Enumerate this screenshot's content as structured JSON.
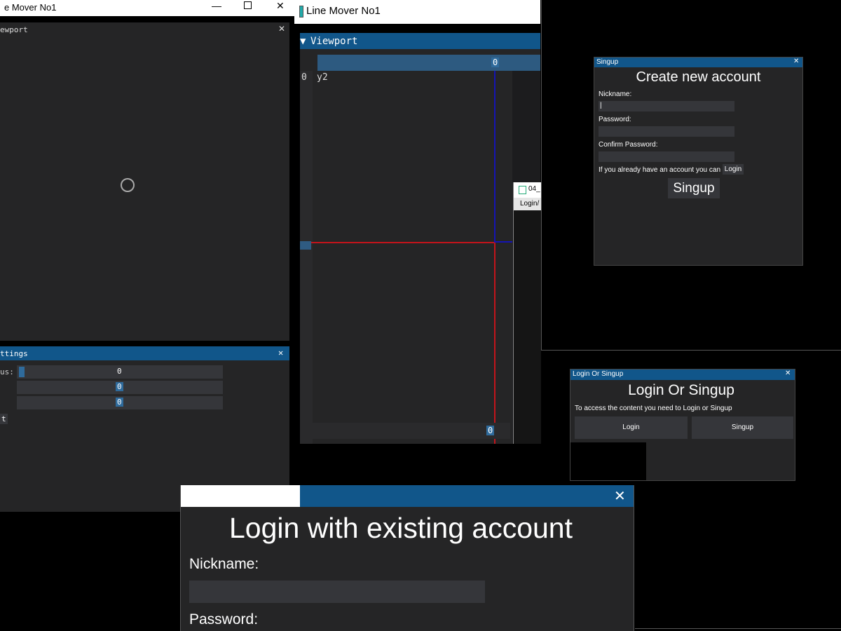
{
  "win1": {
    "title": "e Mover No1",
    "viewport": {
      "title": "ewport"
    },
    "settings": {
      "title": "ttings",
      "row1_label": "us:",
      "row1_value": "0",
      "row2_value": "0",
      "row3_value": "0",
      "footer_label": "t"
    }
  },
  "win2": {
    "title": "Line Mover No1",
    "viewport": {
      "title": "Viewport",
      "top_value": "0",
      "left_value": "0",
      "label": "y2",
      "bottom_value": "0"
    },
    "popup": {
      "title": "04_",
      "tab": "Login/"
    }
  },
  "signup": {
    "title": "Singup",
    "heading": "Create new account",
    "nickname_label": "Nickname:",
    "nickname_value": "|",
    "password_label": "Password:",
    "confirm_label": "Confirm Password:",
    "already_text": "If you already have an account you can",
    "login_button": "Login",
    "signup_button": "Singup"
  },
  "choice": {
    "title": "Login Or Singup",
    "heading": "Login Or Singup",
    "text": "To access the content you need to Login or Singup",
    "login_button": "Login",
    "signup_button": "Singup"
  },
  "login": {
    "heading": "Login with existing account",
    "nickname_label": "Nickname:",
    "password_label": "Password:"
  },
  "colors": {
    "accent": "#11568a",
    "panel": "#252526",
    "field": "#35363a",
    "line_red": "#c4141b",
    "line_blue": "#1414b4"
  }
}
